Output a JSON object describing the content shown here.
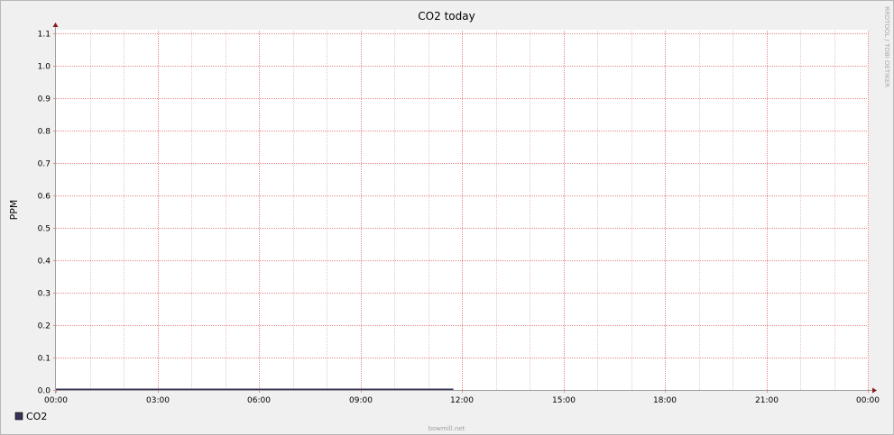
{
  "chart_data": {
    "type": "line",
    "title": "CO2 today",
    "xlabel": "",
    "ylabel": "PPM",
    "x_tick_labels": [
      "00:00",
      "03:00",
      "06:00",
      "09:00",
      "12:00",
      "15:00",
      "18:00",
      "21:00",
      "00:00"
    ],
    "y_tick_labels": [
      "0.0",
      "0.1",
      "0.2",
      "0.3",
      "0.4",
      "0.5",
      "0.6",
      "0.7",
      "0.8",
      "0.9",
      "1.0",
      "1.1"
    ],
    "xlim": [
      0,
      24
    ],
    "ylim": [
      0,
      1.1
    ],
    "x_unit": "hours",
    "grid": true,
    "legend_position": "bottom-left",
    "series": [
      {
        "name": "CO2",
        "color": "#333355",
        "x": [
          0,
          11.75
        ],
        "y": [
          0,
          0
        ]
      }
    ]
  },
  "watermark": "RRDTOOL / TOBI OETIKER",
  "footer": "bowmill.net",
  "colors": {
    "background": "#f0f0f0",
    "plot_area": "#ffffff",
    "major_grid": "#e88a8a",
    "minor_grid": "#e6c8c8",
    "axis": "#a0a0a0",
    "arrow": "#8b1a1a"
  }
}
